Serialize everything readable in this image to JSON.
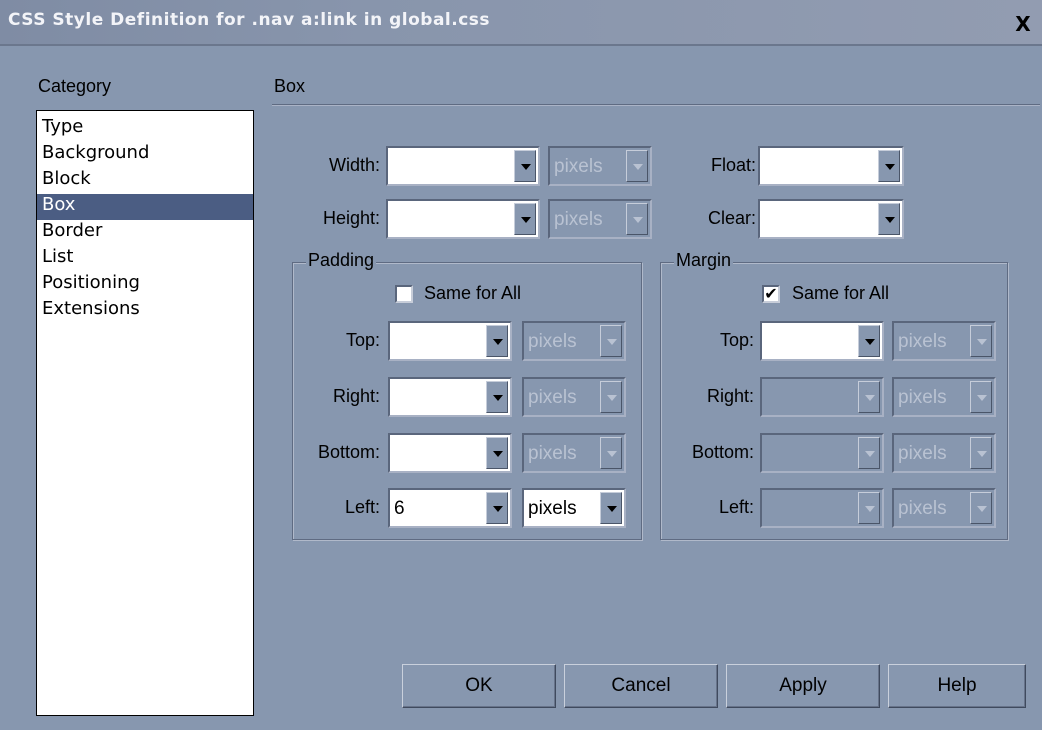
{
  "window": {
    "title": "CSS Style Definition for .nav a:link in global.css"
  },
  "category": {
    "label": "Category",
    "items": [
      "Type",
      "Background",
      "Block",
      "Box",
      "Border",
      "List",
      "Positioning",
      "Extensions"
    ],
    "selected": "Box"
  },
  "panel": {
    "title": "Box"
  },
  "fields": {
    "width": {
      "label": "Width:",
      "value": "",
      "unit": "pixels"
    },
    "height": {
      "label": "Height:",
      "value": "",
      "unit": "pixels"
    },
    "float": {
      "label": "Float:",
      "value": ""
    },
    "clear": {
      "label": "Clear:",
      "value": ""
    }
  },
  "padding": {
    "title": "Padding",
    "same_for_all": {
      "label": "Same for All",
      "checked": false
    },
    "top": {
      "label": "Top:",
      "value": "",
      "unit": "pixels"
    },
    "right": {
      "label": "Right:",
      "value": "",
      "unit": "pixels"
    },
    "bottom": {
      "label": "Bottom:",
      "value": "",
      "unit": "pixels"
    },
    "left": {
      "label": "Left:",
      "value": "6",
      "unit": "pixels"
    }
  },
  "margin": {
    "title": "Margin",
    "same_for_all": {
      "label": "Same for All",
      "checked": true,
      "mark": "✔"
    },
    "top": {
      "label": "Top:",
      "value": "",
      "unit": "pixels"
    },
    "right": {
      "label": "Right:",
      "value": "",
      "unit": "pixels"
    },
    "bottom": {
      "label": "Bottom:",
      "value": "",
      "unit": "pixels"
    },
    "left": {
      "label": "Left:",
      "value": "",
      "unit": "pixels"
    }
  },
  "buttons": {
    "ok": "OK",
    "cancel": "Cancel",
    "apply": "Apply",
    "help": "Help"
  },
  "icons": {
    "close": "X"
  },
  "colors": {
    "background": "#8797af",
    "selection": "#4b5d83"
  }
}
